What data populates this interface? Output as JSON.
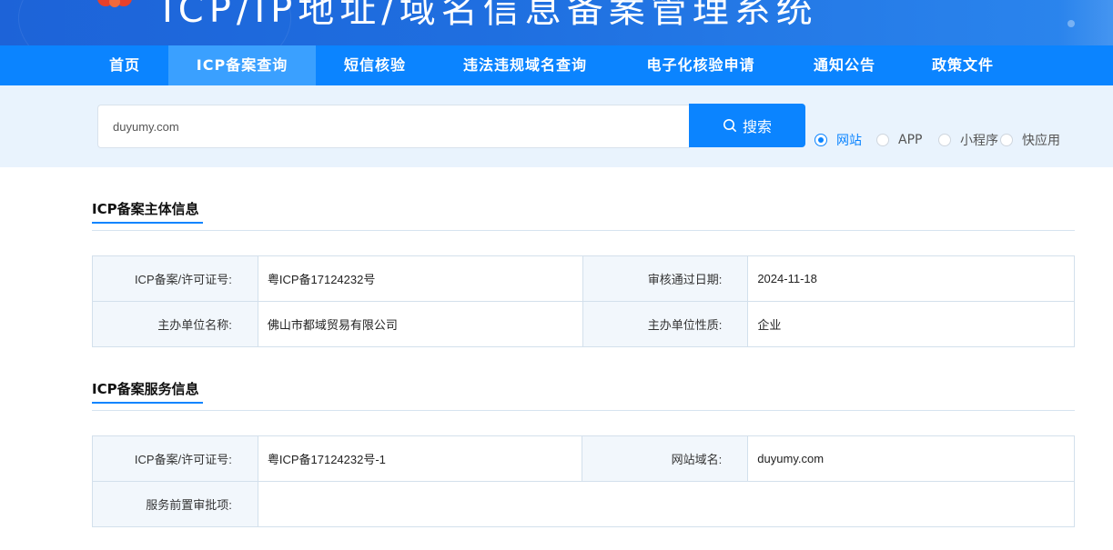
{
  "header": {
    "title": "ICP/IP地址/域名信息备案管理系统"
  },
  "nav": {
    "items": [
      {
        "label": "首页"
      },
      {
        "label": "ICP备案查询"
      },
      {
        "label": "短信核验"
      },
      {
        "label": "违法违规域名查询"
      },
      {
        "label": "电子化核验申请"
      },
      {
        "label": "通知公告"
      },
      {
        "label": "政策文件"
      }
    ],
    "active_index": 1
  },
  "search": {
    "value": "duyumy.com",
    "button_label": "搜索",
    "types": [
      {
        "label": "网站",
        "checked": true
      },
      {
        "label": "APP",
        "checked": false
      },
      {
        "label": "小程序",
        "checked": false
      },
      {
        "label": "快应用",
        "checked": false
      }
    ]
  },
  "subject_info": {
    "title": "ICP备案主体信息",
    "rows": [
      {
        "k1": "ICP备案/许可证号:",
        "v1": "粤ICP备17124232号",
        "k2": "审核通过日期:",
        "v2": "2024-11-18"
      },
      {
        "k1": "主办单位名称:",
        "v1": "佛山市都域贸易有限公司",
        "k2": "主办单位性质:",
        "v2": "企业"
      }
    ]
  },
  "service_info": {
    "title": "ICP备案服务信息",
    "rows": [
      {
        "k1": "ICP备案/许可证号:",
        "v1": "粤ICP备17124232号-1",
        "k2": "网站域名:",
        "v2": "duyumy.com"
      },
      {
        "k1": "服务前置审批项:",
        "v1": ""
      }
    ]
  },
  "colors": {
    "primary": "#0b84ff",
    "nav_active": "#3aa0ff",
    "banner": "#1d63d8",
    "search_bg": "#e9f3fd",
    "label_bg": "#f2f7fc"
  }
}
